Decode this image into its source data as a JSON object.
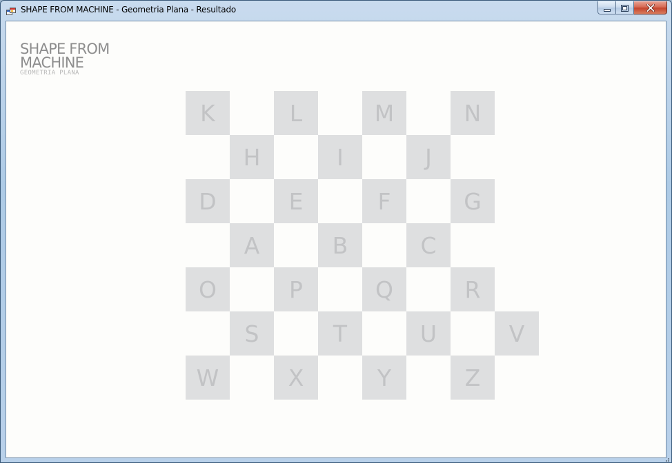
{
  "window": {
    "title": "SHAPE FROM MACHINE - Geometria Plana - Resultado",
    "controls": {
      "minimize": "minimize-icon",
      "maximize": "maximize-icon",
      "close": "close-icon"
    }
  },
  "brand": {
    "line1": "SHAPE FROM",
    "line2": "MACHINE",
    "subtitle": "GEOMETRIA PLANA"
  },
  "board": {
    "tile_color": "#dedfe0",
    "letter_color": "#c2c3c5",
    "rows": [
      [
        "K",
        "L",
        "M",
        "N"
      ],
      [
        "H",
        "I",
        "J"
      ],
      [
        "D",
        "E",
        "F",
        "G"
      ],
      [
        "A",
        "B",
        "C"
      ],
      [
        "O",
        "P",
        "Q",
        "R"
      ],
      [
        "S",
        "T",
        "U",
        "V"
      ],
      [
        "W",
        "X",
        "Y",
        "Z"
      ]
    ]
  },
  "colors": {
    "client_background": "#fdfdfb",
    "close_button": "#c4452e"
  }
}
